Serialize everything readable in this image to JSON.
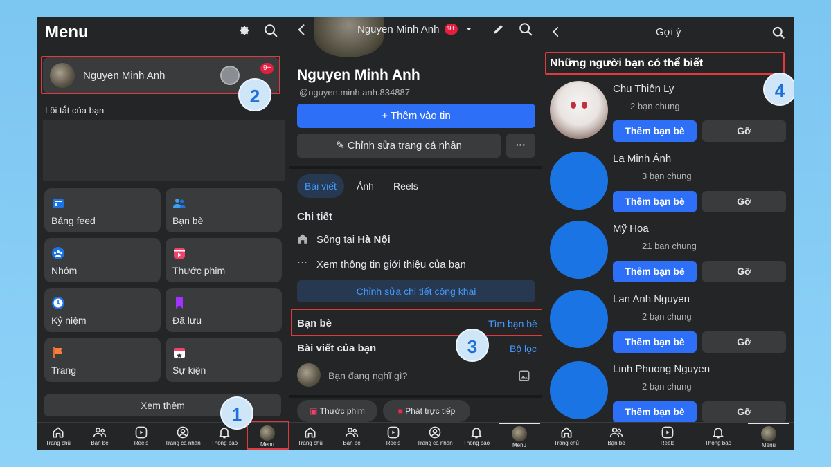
{
  "colors": {
    "accent": "#2d6ff6",
    "panel": "#242526",
    "card": "#3a3b3c",
    "badge": "#e41e3f",
    "callout": "#e0393e"
  },
  "steps": [
    "1",
    "2",
    "3",
    "4"
  ],
  "nav_labels": {
    "home": "Trang chủ",
    "friends": "Bạn bè",
    "reels": "Reels",
    "profile": "Trang cá nhân",
    "notifications": "Thông báo",
    "menu": "Menu"
  },
  "panel1": {
    "title": "Menu",
    "profile_name": "Nguyen Minh Anh",
    "badge": "9+",
    "shortcuts_label": "Lối tắt của bạn",
    "tiles": [
      "Bảng feed",
      "Bạn bè",
      "Nhóm",
      "Thước phim",
      "Kỷ niệm",
      "Đã lưu",
      "Trang",
      "Sự kiện"
    ],
    "see_more": "Xem thêm"
  },
  "panel2": {
    "header_name": "Nguyen Minh Anh",
    "badge": "9+",
    "name": "Nguyen Minh Anh",
    "handle": "@nguyen.minh.anh.834887",
    "add_story": "Thêm vào tin",
    "edit_profile": "Chỉnh sửa trang cá nhân",
    "more": "···",
    "tabs": [
      "Bài viết",
      "Ảnh",
      "Reels"
    ],
    "details_title": "Chi tiết",
    "lives_prefix": "Sống tại ",
    "lives_city": "Hà Nội",
    "see_intro": "Xem thông tin giới thiệu của bạn",
    "edit_details": "Chỉnh sửa chi tiết công khai",
    "friends_title": "Bạn bè",
    "find_friends": "Tìm bạn bè",
    "posts_title": "Bài viết của bạn",
    "filter": "Bộ lọc",
    "composer_placeholder": "Bạn đang nghĩ gì?",
    "reels_chip": "Thước phim",
    "live_chip": "Phát trực tiếp"
  },
  "panel3": {
    "title": "Gợi ý",
    "section_title": "Những người bạn có thể biết",
    "add_label": "Thêm bạn bè",
    "remove_label": "Gỡ",
    "people": [
      {
        "name": "Chu Thiên Ly",
        "mutual": "2 bạn chung"
      },
      {
        "name": "La Minh Ánh",
        "mutual": "3 bạn chung"
      },
      {
        "name": "Mỹ Hoa",
        "mutual": "21 bạn chung"
      },
      {
        "name": "Lan Anh Nguyen",
        "mutual": "2 bạn chung"
      },
      {
        "name": "Linh Phuong Nguyen",
        "mutual": "2 bạn chung"
      }
    ]
  }
}
